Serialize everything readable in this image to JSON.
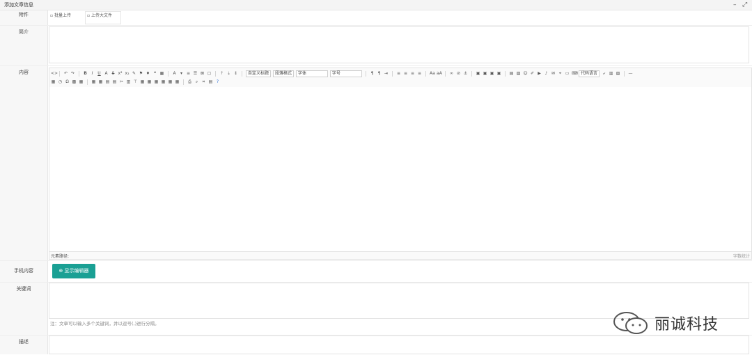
{
  "window": {
    "title": "添加文章信息",
    "minimize": "–",
    "maximize": "⤢"
  },
  "attachment": {
    "label": "附件",
    "upload_button": "批量上传",
    "upload_file_button": "上传大文件"
  },
  "summary": {
    "label": "简介"
  },
  "content": {
    "label": "内容",
    "dropdowns": {
      "custom_title": "自定义标题",
      "paragraph_format": "段落格式",
      "font_family": "字体",
      "font_size": "字号",
      "code_language": "代码语言"
    },
    "status_path": "元素路径:",
    "word_count": "字数统计"
  },
  "mobile": {
    "label": "手机内容",
    "show_editor_button": "显示编辑器"
  },
  "keywords": {
    "label": "关键词",
    "note": "注：文章可以输入多个关键词，并以逗号(,)进行分隔。"
  },
  "description": {
    "label": "描述"
  },
  "watermark": {
    "text": "丽诚科技"
  },
  "colors": {
    "accent": "#1aa094"
  }
}
